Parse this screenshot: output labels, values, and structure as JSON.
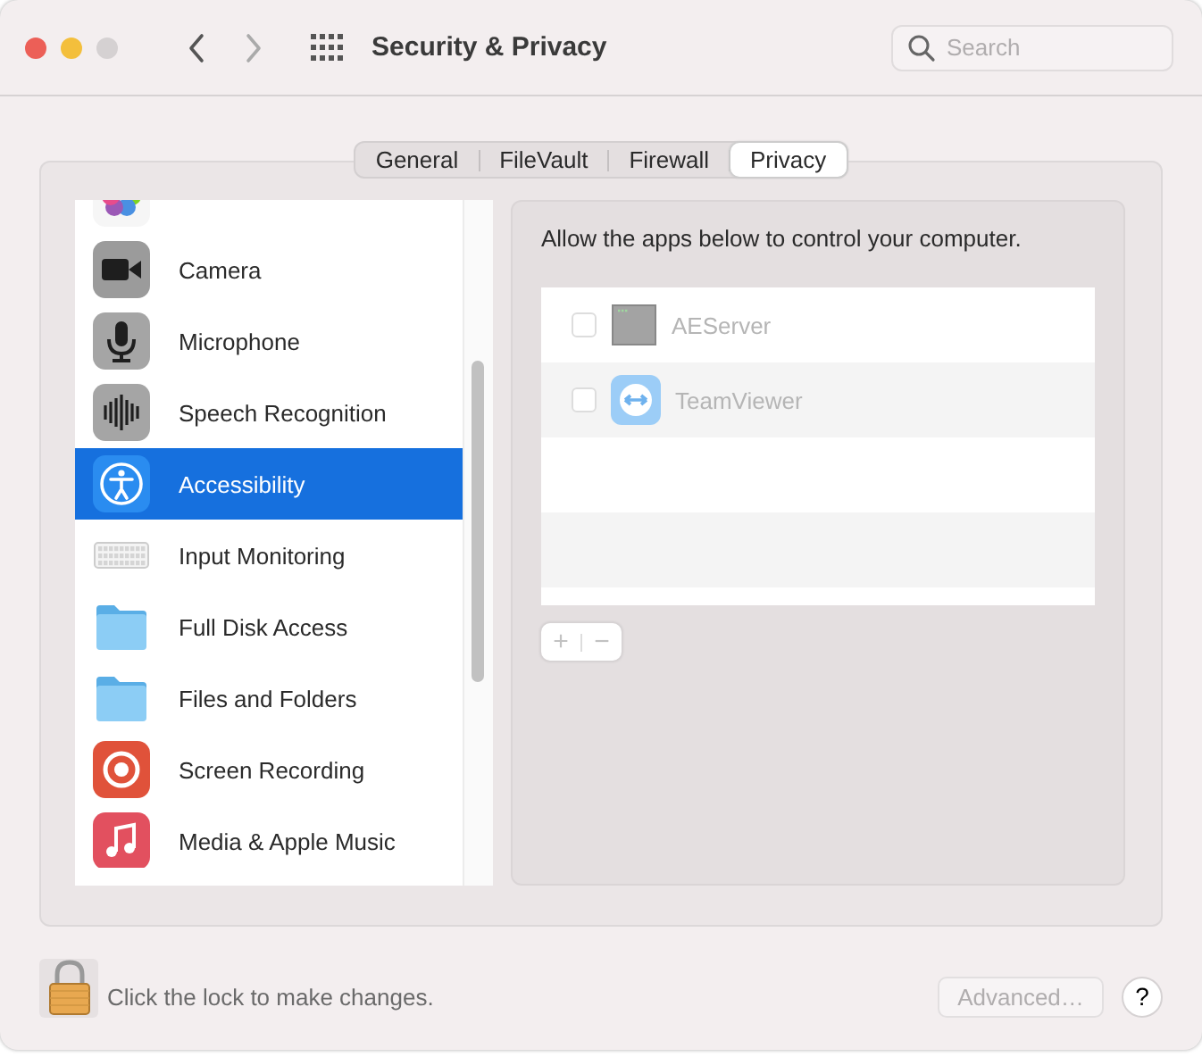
{
  "window": {
    "title": "Security & Privacy"
  },
  "search": {
    "placeholder": "Search"
  },
  "tabs": [
    {
      "label": "General",
      "selected": false
    },
    {
      "label": "FileVault",
      "selected": false
    },
    {
      "label": "Firewall",
      "selected": false
    },
    {
      "label": "Privacy",
      "selected": true
    }
  ],
  "sidebar": {
    "items": [
      {
        "label": "Camera",
        "selected": false
      },
      {
        "label": "Microphone",
        "selected": false
      },
      {
        "label": "Speech Recognition",
        "selected": false
      },
      {
        "label": "Accessibility",
        "selected": true
      },
      {
        "label": "Input Monitoring",
        "selected": false
      },
      {
        "label": "Full Disk Access",
        "selected": false
      },
      {
        "label": "Files and Folders",
        "selected": false
      },
      {
        "label": "Screen Recording",
        "selected": false
      },
      {
        "label": "Media & Apple Music",
        "selected": false
      }
    ]
  },
  "detail": {
    "description": "Allow the apps below to control your computer.",
    "apps": [
      {
        "name": "AEServer",
        "checked": false,
        "disabled": true
      },
      {
        "name": "TeamViewer",
        "checked": false,
        "disabled": true
      }
    ],
    "add_button": {
      "label": "+",
      "disabled": true
    },
    "remove_button": {
      "label": "−",
      "disabled": true
    }
  },
  "footer": {
    "lock_message": "Click the lock to make changes.",
    "advanced_button": {
      "label": "Advanced…",
      "disabled": true
    },
    "help_button": {
      "label": "?"
    }
  }
}
